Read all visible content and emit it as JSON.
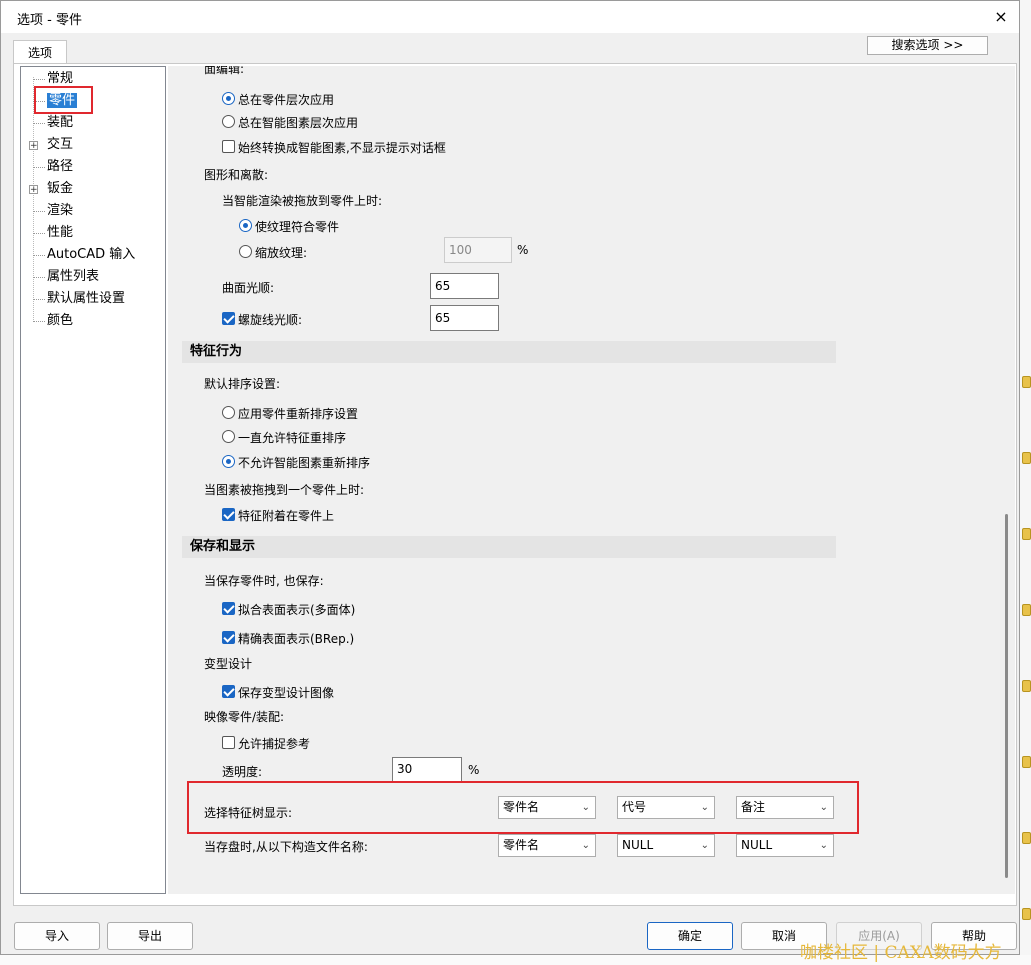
{
  "window": {
    "title": "选项 - 零件",
    "close_icon": "×"
  },
  "tab": {
    "label": "选项"
  },
  "search_button": "搜索选项 >>",
  "tree": {
    "items": [
      {
        "label": "常规",
        "expandable": false
      },
      {
        "label": "零件",
        "expandable": false,
        "selected": true
      },
      {
        "label": "装配",
        "expandable": false
      },
      {
        "label": "交互",
        "expandable": true
      },
      {
        "label": "路径",
        "expandable": false
      },
      {
        "label": "钣金",
        "expandable": true
      },
      {
        "label": "渲染",
        "expandable": false
      },
      {
        "label": "性能",
        "expandable": false
      },
      {
        "label": "AutoCAD 输入",
        "expandable": false
      },
      {
        "label": "属性列表",
        "expandable": false
      },
      {
        "label": "默认属性设置",
        "expandable": false
      },
      {
        "label": "颜色",
        "expandable": false
      }
    ]
  },
  "content": {
    "top_cut_label": "面编辑:",
    "edit_radio1": "总在零件层次应用",
    "edit_radio2": "总在智能图素层次应用",
    "edit_check": "始终转换成智能图素,不显示提示对话框",
    "graphics_label": "图形和离散:",
    "render_drop_label": "当智能渲染被拖放到零件上时:",
    "render_radio1": "使纹理符合零件",
    "render_radio2": "缩放纹理:",
    "scale_value": "100",
    "scale_unit": "%",
    "surface_smooth_label": "曲面光顺:",
    "surface_smooth_value": "65",
    "helix_smooth_label": "螺旋线光顺:",
    "helix_smooth_value": "65",
    "section_feature": "特征行为",
    "default_sort_label": "默认排序设置:",
    "sort_radio1": "应用零件重新排序设置",
    "sort_radio2": "一直允许特征重排序",
    "sort_radio3": "不允许智能图素重新排序",
    "drag_onto_part_label": "当图素被拖拽到一个零件上时:",
    "attach_check": "特征附着在零件上",
    "section_save": "保存和显示",
    "save_also_label": "当保存零件时, 也保存:",
    "save_check1": "拟合表面表示(多面体)",
    "save_check2": "精确表面表示(BRep.)",
    "variant_label": "变型设计",
    "variant_check": "保存变型设计图像",
    "mirror_label": "映像零件/装配:",
    "mirror_check": "允许捕捉参考",
    "transparency_label": "透明度:",
    "transparency_value": "30",
    "transparency_unit": "%",
    "tree_display_label": "选择特征树显示:",
    "tree_display_1": "零件名",
    "tree_display_2": "代号",
    "tree_display_3": "备注",
    "filename_label": "当存盘时,从以下构造文件名称:",
    "filename_1": "零件名",
    "filename_2": "NULL",
    "filename_3": "NULL"
  },
  "buttons": {
    "import": "导入",
    "export": "导出",
    "ok": "确定",
    "cancel": "取消",
    "apply": "应用(A)",
    "help": "帮助"
  },
  "watermark": "咖楼社区 | CAXA数码大方",
  "colors": {
    "accent": "#1a66c4",
    "highlight_box": "#e0282e",
    "selection": "#2a7fd4"
  }
}
